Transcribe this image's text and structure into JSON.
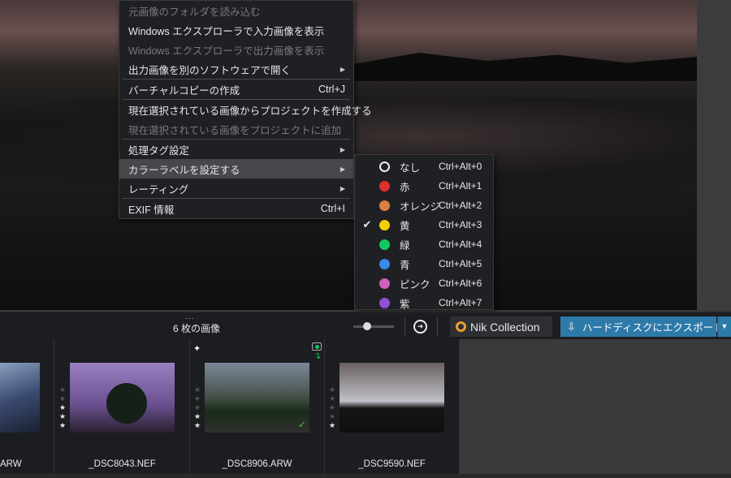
{
  "context_menu": {
    "items": [
      {
        "label": "元画像のフォルダを読み込む",
        "disabled": true
      },
      {
        "label": "Windows エクスプローラで入力画像を表示"
      },
      {
        "label": "Windows エクスプローラで出力画像を表示",
        "disabled": true
      },
      {
        "label": "出力画像を別のソフトウェアで開く",
        "submenu": true,
        "sep_after": true
      },
      {
        "label": "バーチャルコピーの作成",
        "shortcut": "Ctrl+J",
        "sep_after": true
      },
      {
        "label": "現在選択されている画像からプロジェクトを作成する"
      },
      {
        "label": "現在選択されている画像をプロジェクトに追加",
        "disabled": true,
        "sep_after": true
      },
      {
        "label": "処理タグ設定",
        "submenu": true
      },
      {
        "label": "カラーラベルを設定する",
        "submenu": true,
        "highlighted": true
      },
      {
        "label": "レーティング",
        "submenu": true,
        "sep_after": true
      },
      {
        "label": "EXIF 情報",
        "shortcut": "Ctrl+I"
      }
    ]
  },
  "color_label_menu": {
    "items": [
      {
        "label": "なし",
        "shortcut": "Ctrl+Alt+0",
        "color": "none"
      },
      {
        "label": "赤",
        "shortcut": "Ctrl+Alt+1",
        "color": "#e03030"
      },
      {
        "label": "オレンジ",
        "shortcut": "Ctrl+Alt+2",
        "color": "#d98040"
      },
      {
        "label": "黄",
        "shortcut": "Ctrl+Alt+3",
        "color": "#f2d000",
        "checked": true
      },
      {
        "label": "緑",
        "shortcut": "Ctrl+Alt+4",
        "color": "#10c860"
      },
      {
        "label": "青",
        "shortcut": "Ctrl+Alt+5",
        "color": "#3a88e8"
      },
      {
        "label": "ピンク",
        "shortcut": "Ctrl+Alt+6",
        "color": "#d060c0"
      },
      {
        "label": "紫",
        "shortcut": "Ctrl+Alt+7",
        "color": "#9050d8"
      }
    ]
  },
  "toolbar": {
    "image_count": "6 枚の画像",
    "grip": "...",
    "nik_label": "Nik Collection",
    "export_label": "ハードディスクにエクスポート",
    "export_dropdown": "▼",
    "next_icon": "➔"
  },
  "filmstrip": [
    {
      "name": "ARW",
      "rating": null
    },
    {
      "name": "_DSC8043.NEF",
      "rating": 3
    },
    {
      "name": "_DSC8906.ARW",
      "rating": 2,
      "badges": [
        "sparkle-icon",
        "camera-icon",
        "checkmark-icon"
      ]
    },
    {
      "name": "_DSC9590.NEF",
      "rating": 1
    }
  ],
  "check_glyph": "✔",
  "arrow_glyph": "▶",
  "star_glyph": "★"
}
